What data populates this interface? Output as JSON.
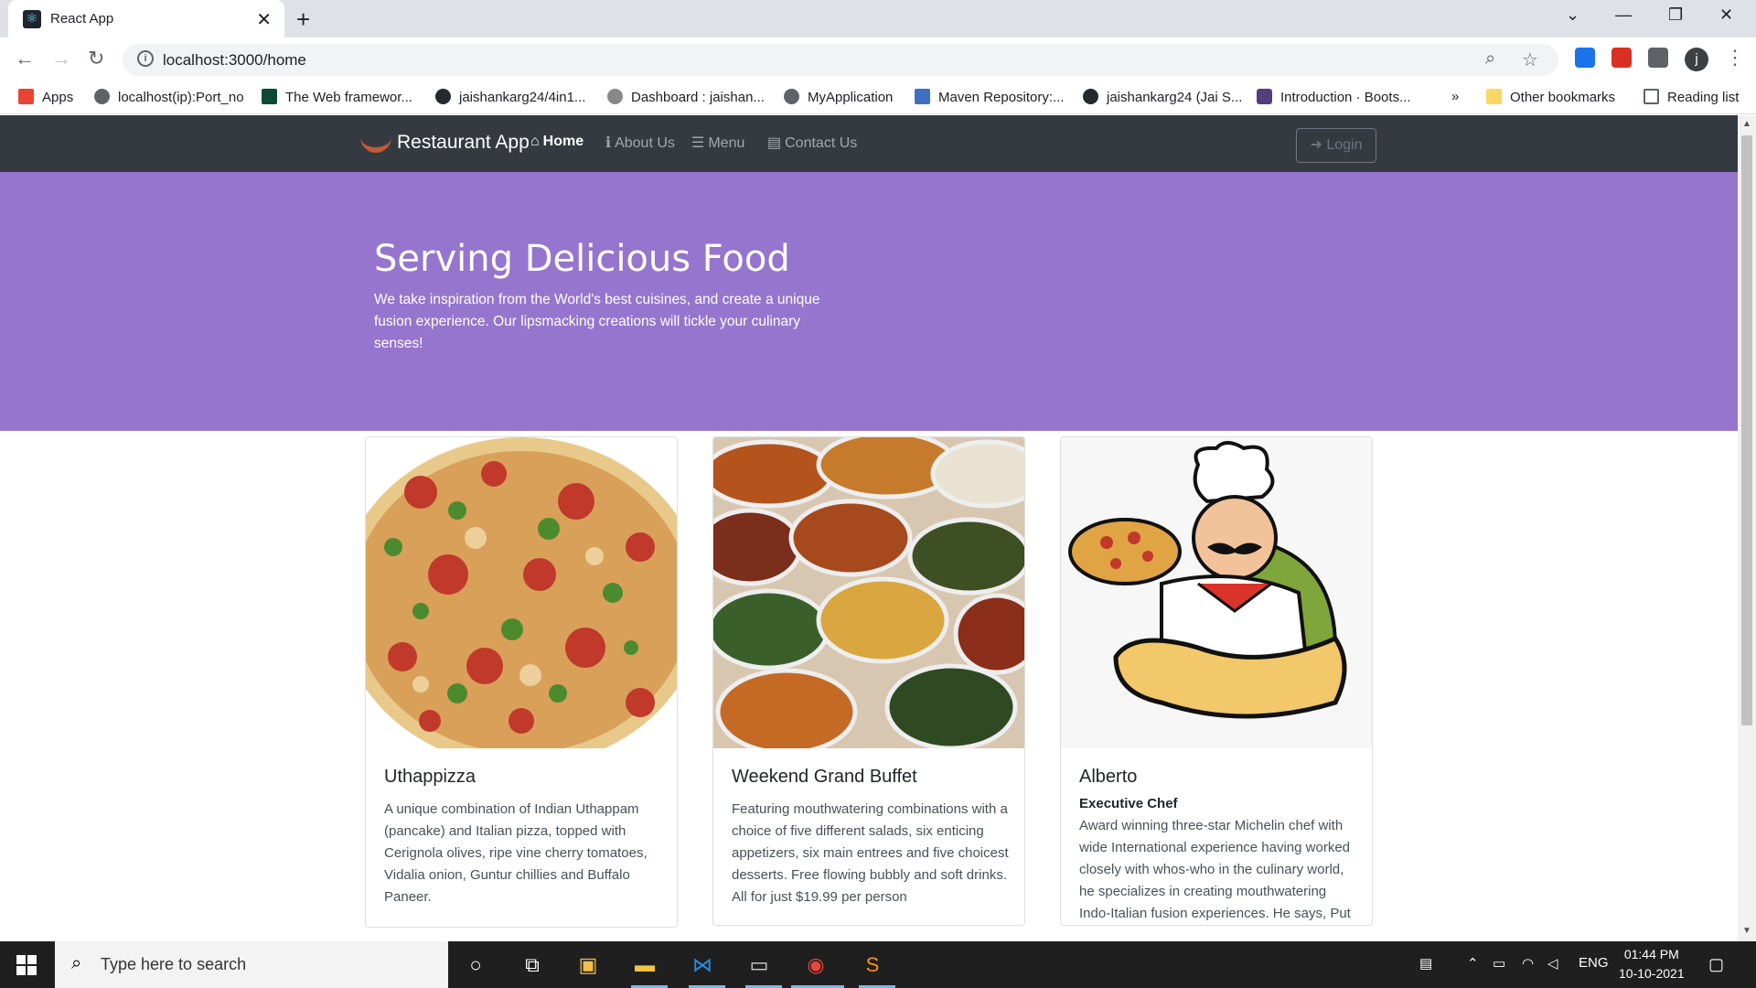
{
  "browser": {
    "tab_title": "React App",
    "url": "localhost:3000/home",
    "bookmarks": [
      "Apps",
      "localhost(ip):Port_no",
      "The Web framewor...",
      "jaishankarg24/4in1...",
      "Dashboard : jaishan...",
      "MyApplication",
      "Maven Repository:...",
      "jaishankarg24 (Jai S...",
      "Introduction · Boots..."
    ],
    "bookmarks_overflow": "»",
    "other_bookmarks": "Other bookmarks",
    "reading_list": "Reading list",
    "profile_initial": "j"
  },
  "navbar": {
    "brand": "Restaurant App",
    "links": [
      {
        "label": "Home",
        "icon": "home-icon"
      },
      {
        "label": "About Us",
        "icon": "info-icon"
      },
      {
        "label": "Menu",
        "icon": "list-icon"
      },
      {
        "label": "Contact Us",
        "icon": "address-card-icon"
      }
    ],
    "login": "Login"
  },
  "jumbotron": {
    "title": "Serving Delicious Food",
    "text": "We take inspiration from the World's best cuisines, and create a unique fusion experience. Our lipsmacking creations will tickle your culinary senses!"
  },
  "cards": [
    {
      "title": "Uthappizza",
      "text": "A unique combination of Indian Uthappam (pancake) and Italian pizza, topped with Cerignola olives, ripe vine cherry tomatoes, Vidalia onion, Guntur chillies and Buffalo Paneer."
    },
    {
      "title": "Weekend Grand Buffet",
      "text": "Featuring mouthwatering combinations with a choice of five different salads, six enticing appetizers, six main entrees and five choicest desserts. Free flowing bubbly and soft drinks. All for just $19.99 per person"
    },
    {
      "title": "Alberto",
      "subtitle": "Executive Chef",
      "text": "Award winning three-star Michelin chef with wide International experience having worked closely with whos-who in the culinary world, he specializes in creating mouthwatering Indo-Italian fusion experiences. He says, Put together the"
    }
  ],
  "taskbar": {
    "search_placeholder": "Type here to search",
    "language": "ENG",
    "time": "01:44 PM",
    "date": "10-10-2021"
  },
  "colors": {
    "navbar_bg": "#343a40",
    "jumbotron_bg": "#9575cd",
    "taskbar_bg": "#1f1f1f"
  }
}
